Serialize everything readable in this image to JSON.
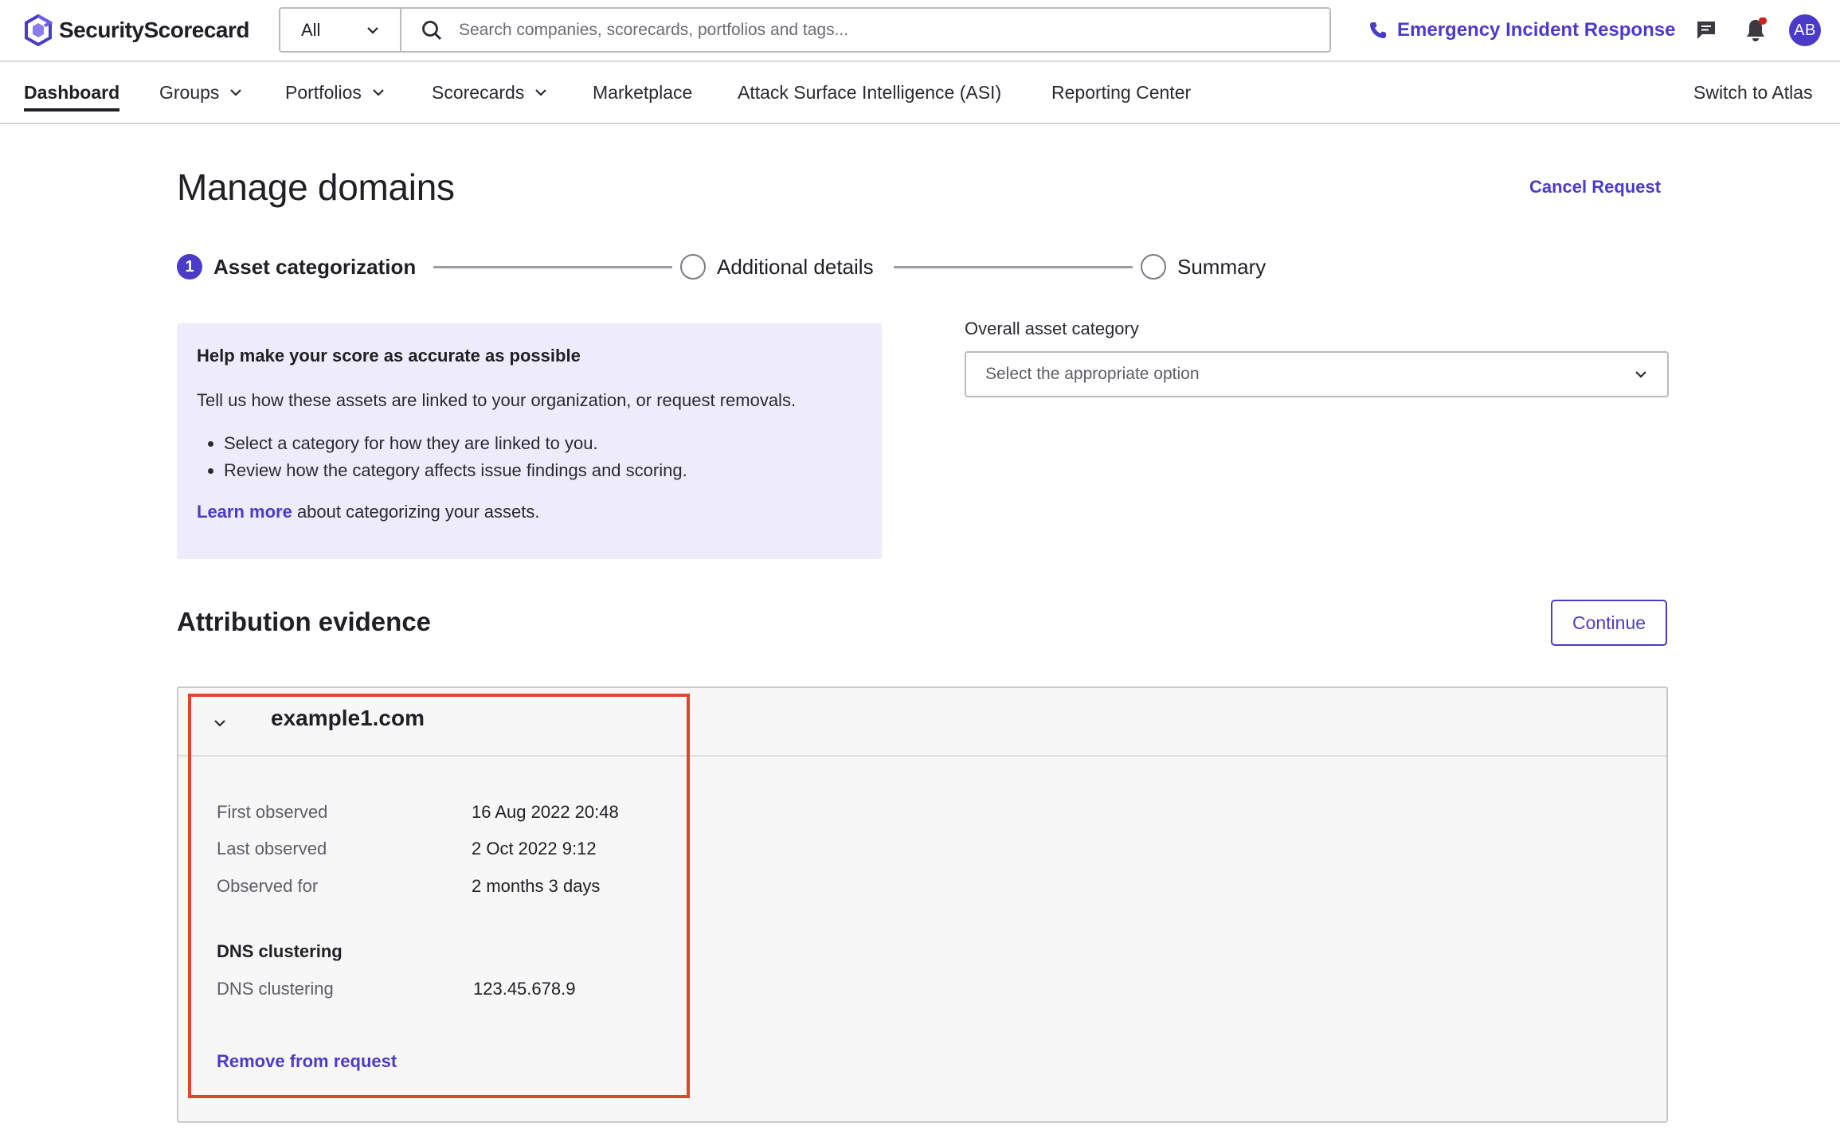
{
  "brand": {
    "name": "SecurityScorecard",
    "accent": "#4a3bc9"
  },
  "search": {
    "scope": "All",
    "placeholder": "Search companies, scorecards, portfolios and tags..."
  },
  "header": {
    "emergency_label": "Emergency Incident Response",
    "avatar_initials": "AB"
  },
  "nav": {
    "items": [
      {
        "label": "Dashboard",
        "active": true,
        "dropdown": false
      },
      {
        "label": "Groups",
        "active": false,
        "dropdown": true
      },
      {
        "label": "Portfolios",
        "active": false,
        "dropdown": true
      },
      {
        "label": "Scorecards",
        "active": false,
        "dropdown": true
      },
      {
        "label": "Marketplace",
        "active": false,
        "dropdown": false
      },
      {
        "label": "Attack Surface Intelligence (ASI)",
        "active": false,
        "dropdown": false
      },
      {
        "label": "Reporting Center",
        "active": false,
        "dropdown": false
      }
    ],
    "switch_label": "Switch to Atlas"
  },
  "page": {
    "title": "Manage domains",
    "cancel_label": "Cancel Request"
  },
  "stepper": {
    "steps": [
      {
        "number": "1",
        "label": "Asset categorization",
        "active": true
      },
      {
        "number": "",
        "label": "Additional details",
        "active": false
      },
      {
        "number": "",
        "label": "Summary",
        "active": false
      }
    ]
  },
  "info": {
    "title": "Help make your score as accurate as possible",
    "text": "Tell us how these assets are linked to your organization, or request removals.",
    "bullets": [
      "Select a category for how they are linked to you.",
      "Review how the category affects issue findings and scoring."
    ],
    "learn_more_link": "Learn more",
    "learn_more_rest": " about categorizing your assets."
  },
  "category": {
    "label": "Overall asset category",
    "placeholder": "Select the appropriate option"
  },
  "evidence": {
    "title": "Attribution evidence",
    "continue_label": "Continue",
    "domain": "example1.com",
    "observations": [
      {
        "label": "First observed",
        "value": "16 Aug 2022 20:48"
      },
      {
        "label": "Last observed",
        "value": "2 Oct 2022 9:12"
      },
      {
        "label": "Observed for",
        "value": "2 months 3 days"
      }
    ],
    "dns_title": "DNS clustering",
    "dns_label": "DNS clustering",
    "dns_value": "123.45.678.9",
    "remove_label": "Remove from request"
  }
}
